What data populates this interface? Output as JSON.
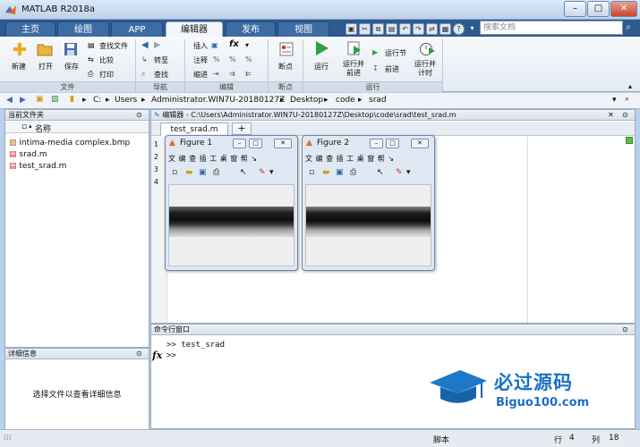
{
  "window": {
    "title": "MATLAB R2018a"
  },
  "tabs": [
    "主页",
    "绘图",
    "APP",
    "编辑器",
    "发布",
    "视图"
  ],
  "active_tab": "编辑器",
  "search_placeholder": "搜索文档",
  "ribbon": {
    "file": {
      "group_label": "文件",
      "new": "新建",
      "open": "打开",
      "save": "保存",
      "find_files": "查找文件",
      "compare": "比较",
      "print": "打印"
    },
    "nav": {
      "group_label": "导航",
      "goto": "转至",
      "find": "查找"
    },
    "edit": {
      "group_label": "编辑",
      "insert": "插入",
      "comment": "注释",
      "indent": "缩进",
      "fx": "fx"
    },
    "breakpoints": {
      "group_label": "断点",
      "breakpoints": "断点"
    },
    "run": {
      "group_label": "运行",
      "run": "运行",
      "run_advance": "运行并\n前进",
      "run_section": "运行节",
      "advance": "前进",
      "run_time": "运行并\n计时"
    }
  },
  "address": {
    "parts": [
      "C:",
      "Users",
      "Administrator.WIN7U-20180127Z",
      "Desktop",
      "code",
      "srad"
    ]
  },
  "current_folder": {
    "title": "当前文件夹",
    "column": "名称",
    "files": [
      "intima-media complex.bmp",
      "srad.m",
      "test_srad.m"
    ]
  },
  "details": {
    "title": "详细信息",
    "placeholder": "选择文件以查看详细信息"
  },
  "editor": {
    "title": "编辑器 - C:\\Users\\Administrator.WIN7U-20180127Z\\Desktop\\code\\srad\\test_srad.m",
    "tab": "test_srad.m",
    "add_tab": "+",
    "line_numbers": [
      "1",
      "2",
      "3",
      "4"
    ]
  },
  "figures": [
    {
      "title": "Figure 1",
      "menu": "文 编 查 插 工 桌 窗 帮 ↘"
    },
    {
      "title": "Figure 2",
      "menu": "文 编 查 插 工 桌 窗 帮 ↘"
    }
  ],
  "command_window": {
    "title": "命令行窗口",
    "lines": [
      ">> test_srad",
      ">>"
    ],
    "fx": "fx"
  },
  "status": {
    "mode": "脚本",
    "row_label": "行",
    "row": "4",
    "col_label": "列",
    "col": "18"
  },
  "watermark": {
    "brand": "必过源码",
    "url": "Biguo100.com"
  }
}
